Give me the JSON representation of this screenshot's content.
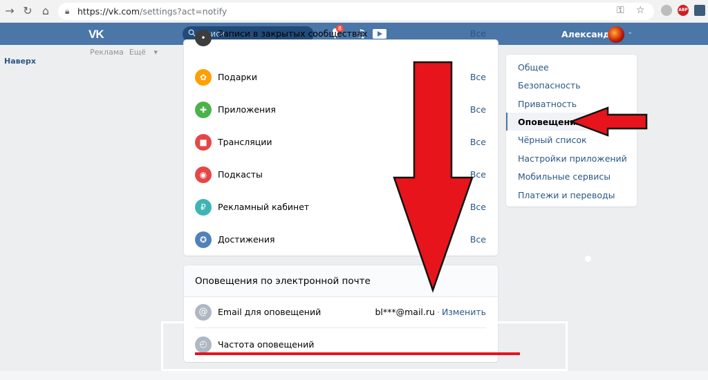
{
  "browser": {
    "url_host": "https://vk.com",
    "url_path": "/settings?act=notify",
    "ext_badge": "ABP"
  },
  "header": {
    "logo": "VK",
    "search_placeholder": "Поиск",
    "notif_count": "8",
    "user_name": "Александра"
  },
  "left": {
    "ads": "Реклама",
    "more": "Ещё",
    "up": "Наверх"
  },
  "notifications": {
    "top_partial_label": "Записи в закрытых сообществах",
    "items": [
      {
        "label": "Подарки",
        "value": "Все",
        "color": "#ffa000",
        "icon": "gift-icon"
      },
      {
        "label": "Приложения",
        "value": "Все",
        "color": "#4bb34b",
        "icon": "gamepad-icon"
      },
      {
        "label": "Трансляции",
        "value": "Все",
        "color": "#e64646",
        "icon": "camera-icon"
      },
      {
        "label": "Подкасты",
        "value": "Все",
        "color": "#e64646",
        "icon": "podcast-icon"
      },
      {
        "label": "Рекламный кабинет",
        "value": "Все",
        "color": "#3fb4b4",
        "icon": "ruble-icon"
      },
      {
        "label": "Достижения",
        "value": "Все",
        "color": "#5181b8",
        "icon": "award-icon"
      }
    ],
    "top_value": "Все"
  },
  "email": {
    "title": "Оповещения по электронной почте",
    "email_label": "Email для оповещений",
    "email_value": "bl***@mail.ru",
    "change": "Изменить",
    "freq_label": "Частота оповещений"
  },
  "menu": {
    "items": [
      "Общее",
      "Безопасность",
      "Приватность",
      "Оповещения",
      "Чёрный список",
      "Настройки приложений",
      "Мобильные сервисы",
      "Платежи и переводы"
    ],
    "active_index": 3
  },
  "colors": {
    "accent": "#4a76a8",
    "link": "#2a5885",
    "annotation": "#e8141c"
  }
}
